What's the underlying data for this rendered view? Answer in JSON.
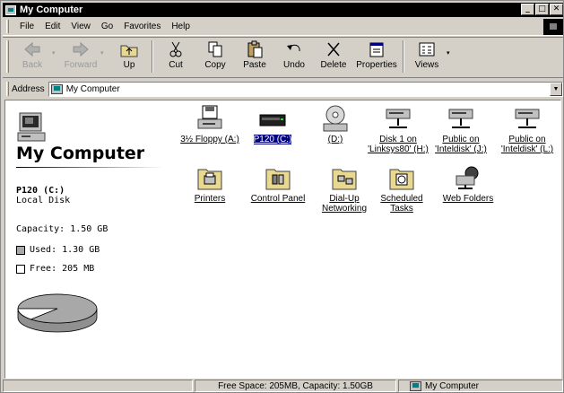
{
  "window": {
    "title": "My Computer",
    "buttons": [
      "_",
      "□",
      "✕"
    ]
  },
  "menu": [
    "File",
    "Edit",
    "View",
    "Go",
    "Favorites",
    "Help"
  ],
  "toolbar": {
    "back": "Back",
    "forward": "Forward",
    "up": "Up",
    "cut": "Cut",
    "copy": "Copy",
    "paste": "Paste",
    "undo": "Undo",
    "delete": "Delete",
    "properties": "Properties",
    "views": "Views"
  },
  "address": {
    "label": "Address",
    "value": "My Computer"
  },
  "left": {
    "title": "My Computer",
    "drive_name": "P120 (C:)",
    "drive_type": "Local Disk",
    "capacity": "Capacity: 1.50 GB",
    "used": "Used: 1.30 GB",
    "free": "Free: 205 MB",
    "used_color": "#a8a8a8",
    "free_color": "#ffffff",
    "used_fraction": 0.867
  },
  "items": [
    {
      "label": "3½ Floppy (A:)",
      "icon": "floppy-drive-icon"
    },
    {
      "label": "P120 (C:)",
      "icon": "hard-drive-icon",
      "selected": true
    },
    {
      "label": "(D:)",
      "icon": "cd-drive-icon"
    },
    {
      "label": "Disk 1 on",
      "label2": "'Linksys80' (H:)",
      "icon": "network-drive-icon"
    },
    {
      "label": "Public on",
      "label2": "'Inteldisk' (J:)",
      "icon": "network-drive-icon"
    },
    {
      "label": "Public on",
      "label2": "'Inteldisk' (L:)",
      "icon": "network-drive-icon"
    },
    {
      "label": "Printers",
      "icon": "printers-folder-icon"
    },
    {
      "label": "Control Panel",
      "icon": "control-panel-folder-icon"
    },
    {
      "label": "Dial-Up",
      "label2": "Networking",
      "icon": "dialup-networking-folder-icon"
    },
    {
      "label": "Scheduled",
      "label2": "Tasks",
      "icon": "scheduled-tasks-folder-icon"
    },
    {
      "label": "Web Folders",
      "icon": "web-folders-icon"
    }
  ],
  "status": {
    "free_space": "Free Space: 205MB,  Capacity: 1.50GB",
    "location": "My Computer"
  }
}
